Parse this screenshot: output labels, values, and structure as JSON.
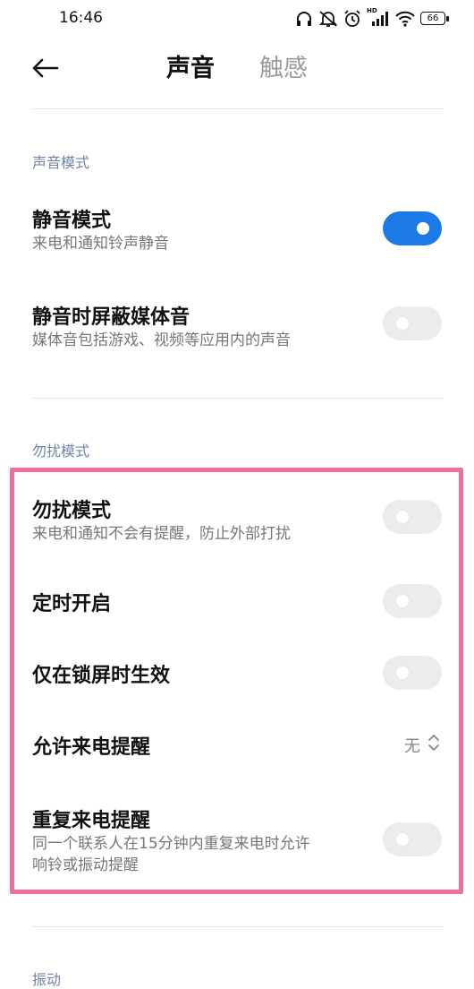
{
  "status_bar": {
    "time": "16:46",
    "icons": [
      "headphones-icon",
      "mute-ring-icon",
      "alarm-icon",
      "hd-signal-icon",
      "wifi-icon",
      "battery-icon"
    ],
    "hd_label": "HD",
    "battery_level": "66"
  },
  "header": {
    "back_icon": "arrow-left-icon",
    "tabs": [
      {
        "label": "声音",
        "active": true
      },
      {
        "label": "触感",
        "active": false
      }
    ]
  },
  "sections": {
    "sound_mode": {
      "title": "声音模式",
      "items": [
        {
          "title": "静音模式",
          "subtitle": "来电和通知铃声静音",
          "toggle": "on"
        },
        {
          "title": "静音时屏蔽媒体音",
          "subtitle": "媒体音包括游戏、视频等应用内的声音",
          "toggle": "off"
        }
      ]
    },
    "dnd": {
      "title": "勿扰模式",
      "items": [
        {
          "title": "勿扰模式",
          "subtitle": "来电和通知不会有提醒，防止外部打扰",
          "toggle": "off"
        },
        {
          "title": "定时开启",
          "toggle": "off"
        },
        {
          "title": "仅在锁屏时生效",
          "toggle": "off"
        },
        {
          "title": "允许来电提醒",
          "value": "无"
        },
        {
          "title": "重复来电提醒",
          "subtitle_line1": "同一个联系人在15分钟内重复来电时允许",
          "subtitle_line2": "响铃或振动提醒",
          "toggle": "off"
        }
      ]
    },
    "vibration": {
      "title": "振动"
    }
  },
  "colors": {
    "accent": "#1c7ae6",
    "section_title": "#6f86a6",
    "toggle_off": "#ececec",
    "highlight": "#ef6f9a"
  }
}
